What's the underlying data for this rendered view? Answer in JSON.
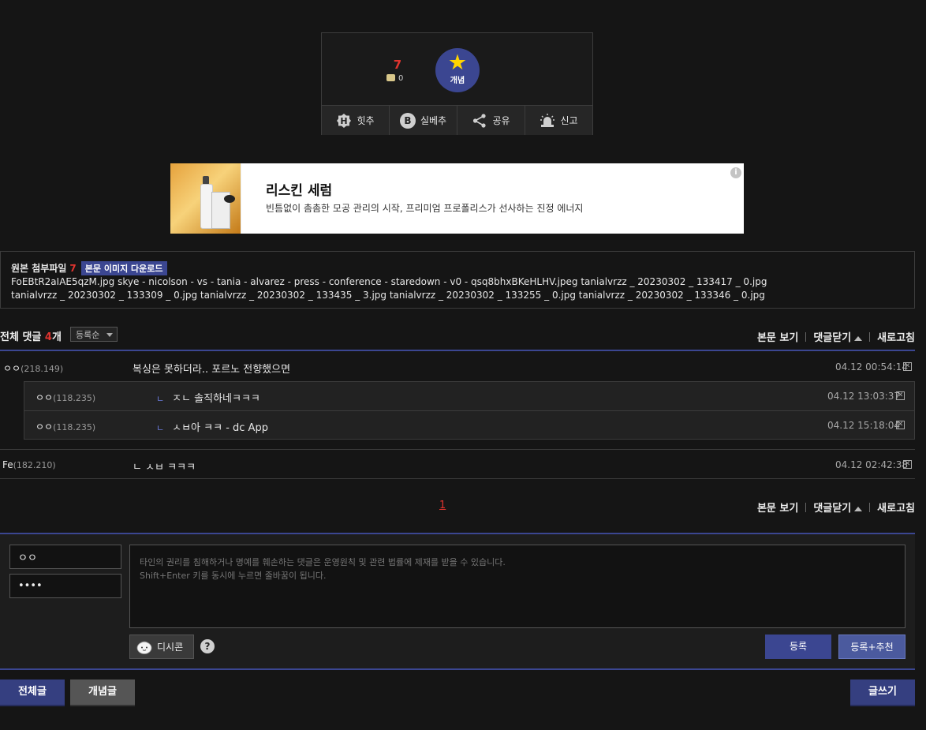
{
  "vote": {
    "count": "7",
    "fixed_count": "0",
    "recommend_label": "개념",
    "actions": [
      {
        "icon": "hit-icon",
        "glyph": "H",
        "label": "힛추"
      },
      {
        "icon": "best-icon",
        "glyph": "B",
        "label": "실베추"
      },
      {
        "icon": "share-icon",
        "label": "공유"
      },
      {
        "icon": "siren-icon",
        "label": "신고"
      }
    ]
  },
  "ad": {
    "title": "리스킨 세럼",
    "description": "빈틈없이 촘촘한 모공 관리의 시작, 프리미엄 프로폴리스가 선사하는 진정 에너지",
    "info_glyph": "i"
  },
  "attachments": {
    "label": "원본 첨부파일",
    "count": "7",
    "download_label": "본문 이미지 다운로드",
    "line1": "FoEBtR2aIAE5qzM.jpg  skye - nicolson - vs - tania - alvarez - press - conference - staredown - v0 - qsq8bhxBKeHLHV.jpeg  tanialvrzz _ 20230302 _ 133417 _ 0.jpg",
    "line2": "tanialvrzz _ 20230302 _ 133309 _ 0.jpg  tanialvrzz _ 20230302 _ 133435 _ 3.jpg  tanialvrzz _ 20230302 _ 133255 _ 0.jpg  tanialvrzz _ 20230302 _ 133346 _ 0.jpg"
  },
  "comments_header": {
    "title": "전체 댓글",
    "count": "4",
    "unit": "개",
    "sort": "등록순",
    "view_post": "본문 보기",
    "close_comments": "댓글닫기",
    "refresh": "새로고침"
  },
  "comments": [
    {
      "nick": "ㅇㅇ",
      "ip": "(218.149)",
      "text": "복싱은 못하더라.. 포르노 전향했으면",
      "date": "04.12 00:54:14"
    },
    {
      "nick": "Fe",
      "ip": "(182.210)",
      "text": "ㄴ ㅅㅂ ㅋㅋㅋ",
      "date": "04.12 02:42:38"
    }
  ],
  "replies": [
    {
      "nick": "ㅇㅇ",
      "ip": "(118.235)",
      "mark": "ㄴ",
      "text": "ㅈㄴ 솔직하네ㅋㅋㅋ",
      "date": "04.12 13:03:37"
    },
    {
      "nick": "ㅇㅇ",
      "ip": "(118.235)",
      "mark": "ㄴ",
      "text": "ㅅㅂ아 ㅋㅋ - dc App",
      "date": "04.12 15:18:04"
    }
  ],
  "pagination": {
    "current": "1"
  },
  "write": {
    "nick_value": "ㅇㅇ",
    "password_value": "••••",
    "placeholder": "타인의 권리를 침해하거나 명예를 훼손하는 댓글은 운영원칙 및 관련 법률에 제재를 받을 수 있습니다.\nShift+Enter 키를 동시에 누르면 줄바꿈이 됩니다.",
    "dccon_label": "디시콘",
    "help_glyph": "?",
    "submit_label": "등록",
    "submit_recommend_label": "등록+추천"
  },
  "bottom": {
    "all_label": "전체글",
    "concept_label": "개념글",
    "write_label": "글쓰기"
  },
  "colors": {
    "accent": "#3b4691",
    "highlight": "#e0342f",
    "background": "#151515"
  }
}
